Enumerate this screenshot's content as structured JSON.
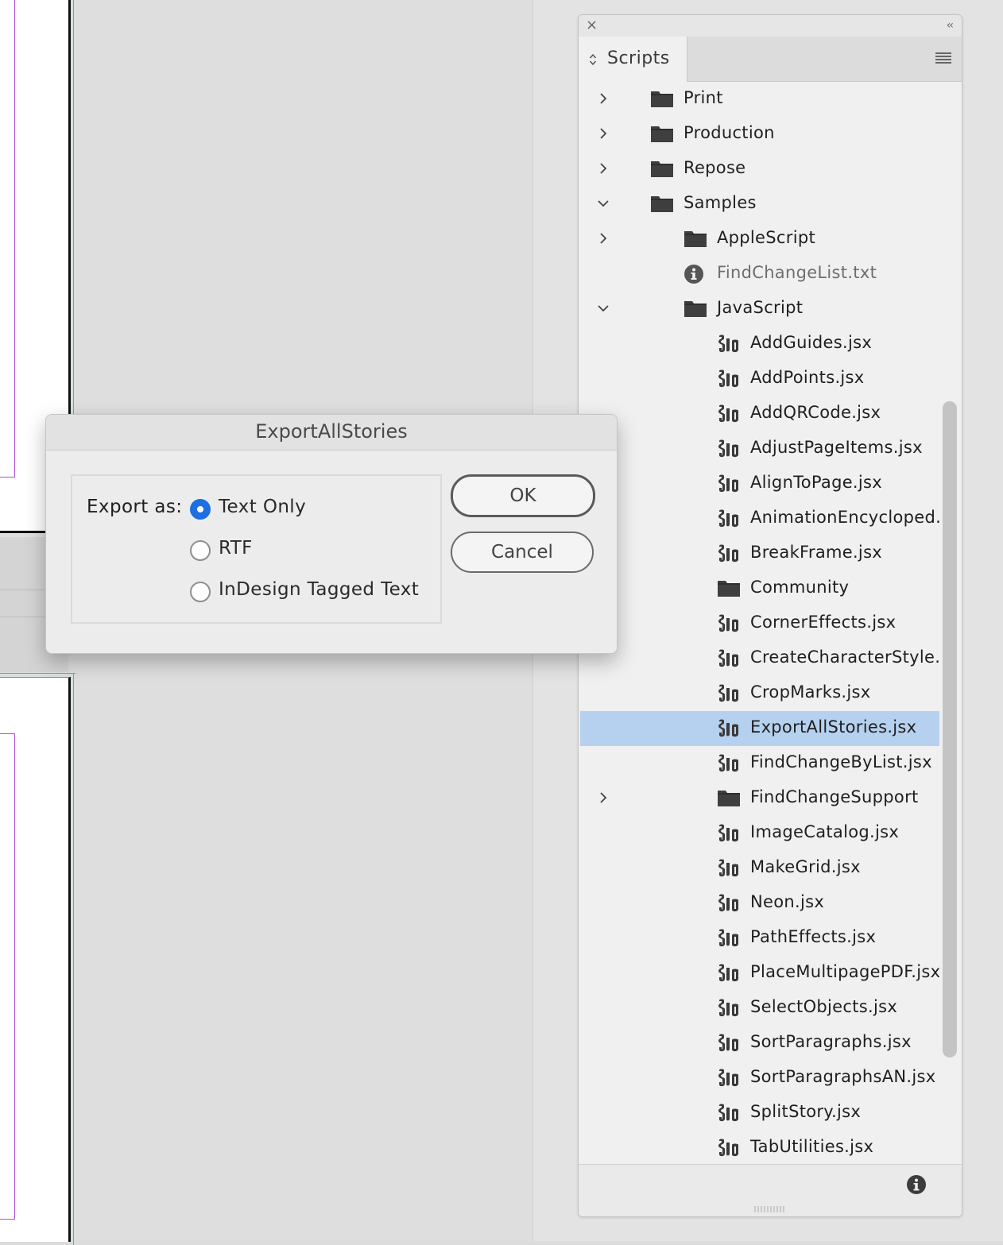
{
  "panel": {
    "tab_label": "Scripts",
    "colors": {
      "selected_row": "#b5d1ef",
      "accent": "#1e6fe0"
    }
  },
  "tree": [
    {
      "label": "Print",
      "kind": "folder",
      "level": 0,
      "disclosure": "collapsed"
    },
    {
      "label": "Production",
      "kind": "folder",
      "level": 0,
      "disclosure": "collapsed"
    },
    {
      "label": "Repose",
      "kind": "folder",
      "level": 0,
      "disclosure": "collapsed"
    },
    {
      "label": "Samples",
      "kind": "folder",
      "level": 0,
      "disclosure": "expanded"
    },
    {
      "label": "AppleScript",
      "kind": "folder",
      "level": 1,
      "disclosure": "collapsed"
    },
    {
      "label": "FindChangeList.txt",
      "kind": "info",
      "level": 1,
      "disclosure": "none"
    },
    {
      "label": "JavaScript",
      "kind": "folder",
      "level": 1,
      "disclosure": "expanded"
    },
    {
      "label": "AddGuides.jsx",
      "kind": "script",
      "level": 2,
      "disclosure": "none"
    },
    {
      "label": "AddPoints.jsx",
      "kind": "script",
      "level": 2,
      "disclosure": "none"
    },
    {
      "label": "AddQRCode.jsx",
      "kind": "script",
      "level": 2,
      "disclosure": "none"
    },
    {
      "label": "AdjustPageItems.jsx",
      "kind": "script",
      "level": 2,
      "disclosure": "none"
    },
    {
      "label": "AlignToPage.jsx",
      "kind": "script",
      "level": 2,
      "disclosure": "none"
    },
    {
      "label": "AnimationEncycloped...",
      "kind": "script",
      "level": 2,
      "disclosure": "none"
    },
    {
      "label": "BreakFrame.jsx",
      "kind": "script",
      "level": 2,
      "disclosure": "none"
    },
    {
      "label": "Community",
      "kind": "folder",
      "level": 2,
      "disclosure": "none"
    },
    {
      "label": "CornerEffects.jsx",
      "kind": "script",
      "level": 2,
      "disclosure": "none"
    },
    {
      "label": "CreateCharacterStyle....",
      "kind": "script",
      "level": 2,
      "disclosure": "none"
    },
    {
      "label": "CropMarks.jsx",
      "kind": "script",
      "level": 2,
      "disclosure": "none"
    },
    {
      "label": "ExportAllStories.jsx",
      "kind": "script",
      "level": 2,
      "disclosure": "none",
      "selected": true
    },
    {
      "label": "FindChangeByList.jsx",
      "kind": "script",
      "level": 2,
      "disclosure": "none"
    },
    {
      "label": "FindChangeSupport",
      "kind": "folder",
      "level": 2,
      "disclosure": "collapsed"
    },
    {
      "label": "ImageCatalog.jsx",
      "kind": "script",
      "level": 2,
      "disclosure": "none"
    },
    {
      "label": "MakeGrid.jsx",
      "kind": "script",
      "level": 2,
      "disclosure": "none"
    },
    {
      "label": "Neon.jsx",
      "kind": "script",
      "level": 2,
      "disclosure": "none"
    },
    {
      "label": "PathEffects.jsx",
      "kind": "script",
      "level": 2,
      "disclosure": "none"
    },
    {
      "label": "PlaceMultipagePDF.jsx",
      "kind": "script",
      "level": 2,
      "disclosure": "none"
    },
    {
      "label": "SelectObjects.jsx",
      "kind": "script",
      "level": 2,
      "disclosure": "none"
    },
    {
      "label": "SortParagraphs.jsx",
      "kind": "script",
      "level": 2,
      "disclosure": "none"
    },
    {
      "label": "SortParagraphsAN.jsx",
      "kind": "script",
      "level": 2,
      "disclosure": "none"
    },
    {
      "label": "SplitStory.jsx",
      "kind": "script",
      "level": 2,
      "disclosure": "none"
    },
    {
      "label": "TabUtilities.jsx",
      "kind": "script",
      "level": 2,
      "disclosure": "none"
    }
  ],
  "dialog": {
    "title": "ExportAllStories",
    "export_label": "Export as:",
    "options": [
      {
        "label": "Text Only",
        "checked": true
      },
      {
        "label": "RTF",
        "checked": false
      },
      {
        "label": "InDesign Tagged Text",
        "checked": false
      }
    ],
    "ok_label": "OK",
    "cancel_label": "Cancel"
  }
}
